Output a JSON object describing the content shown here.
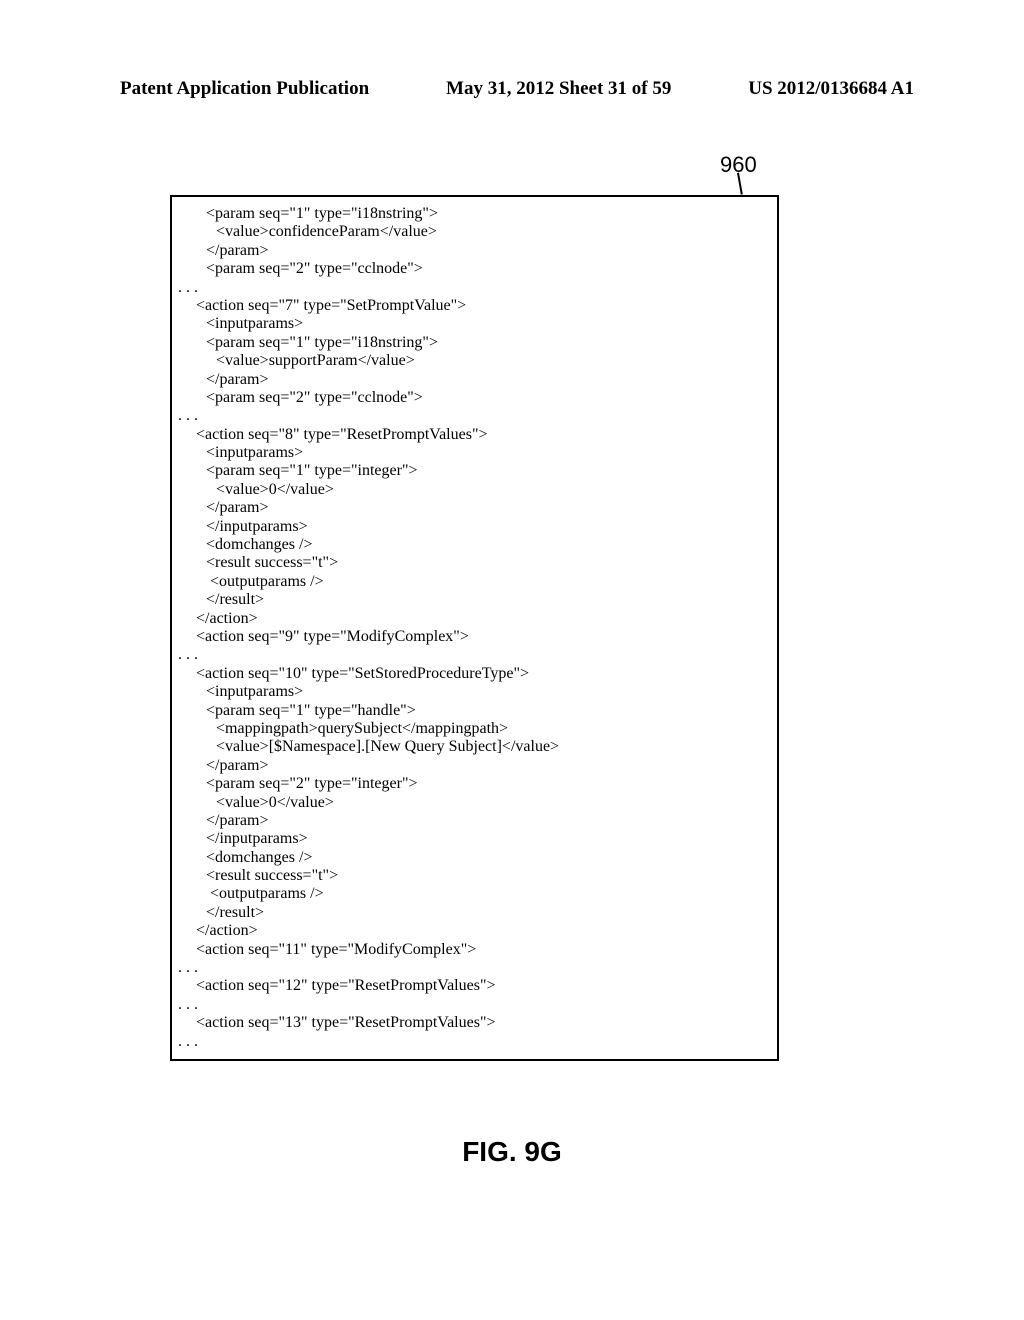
{
  "header": {
    "left": "Patent Application Publication",
    "center": "May 31, 2012   Sheet 31 of 59",
    "right": "US 2012/0136684 A1"
  },
  "figure_ref": "960",
  "code_lines": [
    {
      "cls": "i2",
      "t": "<param seq=\"1\" type=\"i18nstring\">"
    },
    {
      "cls": "i3",
      "t": "<value>confidenceParam</value>"
    },
    {
      "cls": "i2",
      "t": "</param>"
    },
    {
      "cls": "i2",
      "t": "<param seq=\"2\" type=\"cclnode\">"
    },
    {
      "cls": "i0",
      "t": ". . ."
    },
    {
      "cls": "i1",
      "t": "<action seq=\"7\" type=\"SetPromptValue\">"
    },
    {
      "cls": "i2",
      "t": "<inputparams>"
    },
    {
      "cls": "i2",
      "t": "<param seq=\"1\" type=\"i18nstring\">"
    },
    {
      "cls": "i3",
      "t": "<value>supportParam</value>"
    },
    {
      "cls": "i2",
      "t": "</param>"
    },
    {
      "cls": "i2",
      "t": "<param seq=\"2\" type=\"cclnode\">"
    },
    {
      "cls": "i0",
      "t": ". . ."
    },
    {
      "cls": "i1",
      "t": "<action seq=\"8\" type=\"ResetPromptValues\">"
    },
    {
      "cls": "i2",
      "t": "<inputparams>"
    },
    {
      "cls": "i2",
      "t": "<param seq=\"1\" type=\"integer\">"
    },
    {
      "cls": "i3",
      "t": "<value>0</value>"
    },
    {
      "cls": "i2",
      "t": "</param>"
    },
    {
      "cls": "i2",
      "t": "</inputparams>"
    },
    {
      "cls": "i2",
      "t": "<domchanges />"
    },
    {
      "cls": "i2",
      "t": "<result success=\"t\">"
    },
    {
      "cls": "i2",
      "t": " <outputparams />"
    },
    {
      "cls": "i2",
      "t": "</result>"
    },
    {
      "cls": "i1",
      "t": "</action>"
    },
    {
      "cls": "i1",
      "t": "<action seq=\"9\" type=\"ModifyComplex\">"
    },
    {
      "cls": "i0",
      "t": ". . ."
    },
    {
      "cls": "i1",
      "t": "<action seq=\"10\" type=\"SetStoredProcedureType\">"
    },
    {
      "cls": "i2",
      "t": "<inputparams>"
    },
    {
      "cls": "i2",
      "t": "<param seq=\"1\" type=\"handle\">"
    },
    {
      "cls": "i3",
      "t": "<mappingpath>querySubject</mappingpath>"
    },
    {
      "cls": "i3",
      "t": "<value>[$Namespace].[New Query Subject]</value>"
    },
    {
      "cls": "i2",
      "t": "</param>"
    },
    {
      "cls": "i2",
      "t": "<param seq=\"2\" type=\"integer\">"
    },
    {
      "cls": "i3",
      "t": "<value>0</value>"
    },
    {
      "cls": "i2",
      "t": "</param>"
    },
    {
      "cls": "i2",
      "t": "</inputparams>"
    },
    {
      "cls": "i2",
      "t": "<domchanges />"
    },
    {
      "cls": "i2",
      "t": "<result success=\"t\">"
    },
    {
      "cls": "i2",
      "t": " <outputparams />"
    },
    {
      "cls": "i2",
      "t": "</result>"
    },
    {
      "cls": "i1",
      "t": "</action>"
    },
    {
      "cls": "i1",
      "t": "<action seq=\"11\" type=\"ModifyComplex\">"
    },
    {
      "cls": "i0",
      "t": ". . ."
    },
    {
      "cls": "i1",
      "t": "<action seq=\"12\" type=\"ResetPromptValues\">"
    },
    {
      "cls": "i0",
      "t": ". . ."
    },
    {
      "cls": "i1",
      "t": "<action seq=\"13\" type=\"ResetPromptValues\">"
    },
    {
      "cls": "i0",
      "t": ". . ."
    }
  ],
  "figure_caption": "FIG. 9G"
}
